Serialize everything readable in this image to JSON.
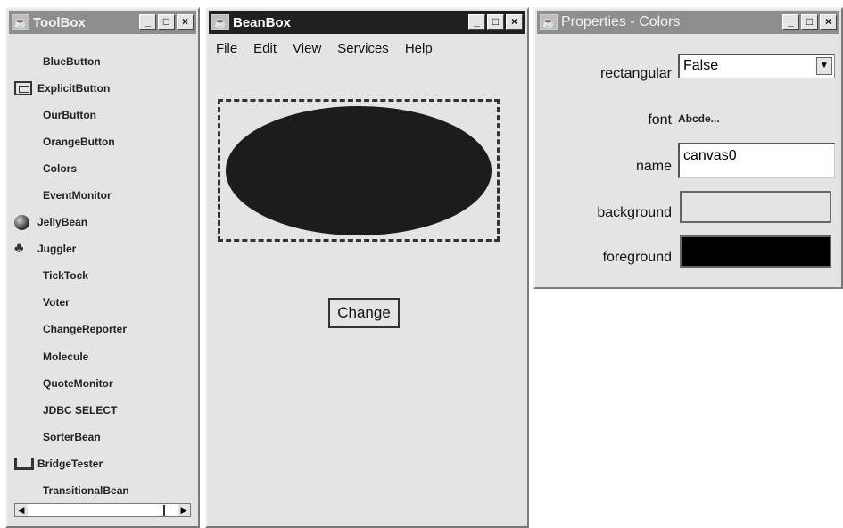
{
  "toolbox": {
    "title": "ToolBox",
    "window_buttons": [
      "_",
      "□",
      "×"
    ],
    "items": [
      {
        "label": "BlueButton",
        "icon": ""
      },
      {
        "label": "ExplicitButton",
        "icon": "explicit-button-icon"
      },
      {
        "label": "OurButton",
        "icon": ""
      },
      {
        "label": "OrangeButton",
        "icon": ""
      },
      {
        "label": "Colors",
        "icon": ""
      },
      {
        "label": "EventMonitor",
        "icon": ""
      },
      {
        "label": "JellyBean",
        "icon": "jelly-bean-icon"
      },
      {
        "label": "Juggler",
        "icon": "juggler-icon"
      },
      {
        "label": "TickTock",
        "icon": ""
      },
      {
        "label": "Voter",
        "icon": ""
      },
      {
        "label": "ChangeReporter",
        "icon": ""
      },
      {
        "label": "Molecule",
        "icon": ""
      },
      {
        "label": "QuoteMonitor",
        "icon": ""
      },
      {
        "label": "JDBC SELECT",
        "icon": ""
      },
      {
        "label": "SorterBean",
        "icon": ""
      },
      {
        "label": "BridgeTester",
        "icon": "bridge-icon"
      },
      {
        "label": "TransitionalBean",
        "icon": ""
      }
    ],
    "scroll_left": "◀",
    "scroll_right": "▶"
  },
  "beanbox": {
    "title": "BeanBox",
    "window_buttons": [
      "_",
      "□",
      "×"
    ],
    "menu": [
      "File",
      "Edit",
      "View",
      "Services",
      "Help"
    ],
    "button_label": "Change",
    "ellipse_color": "#1c1c1c"
  },
  "properties": {
    "title": "Properties - Colors",
    "window_buttons": [
      "_",
      "□",
      "×"
    ],
    "rows": {
      "rectangular": {
        "label": "rectangular",
        "value": "False"
      },
      "font": {
        "label": "font",
        "value": "Abcde..."
      },
      "name": {
        "label": "name",
        "value": "canvas0"
      },
      "background": {
        "label": "background",
        "color": "#e4e4e4"
      },
      "foreground": {
        "label": "foreground",
        "color": "#000000"
      }
    },
    "dropdown_arrow": "▼"
  }
}
